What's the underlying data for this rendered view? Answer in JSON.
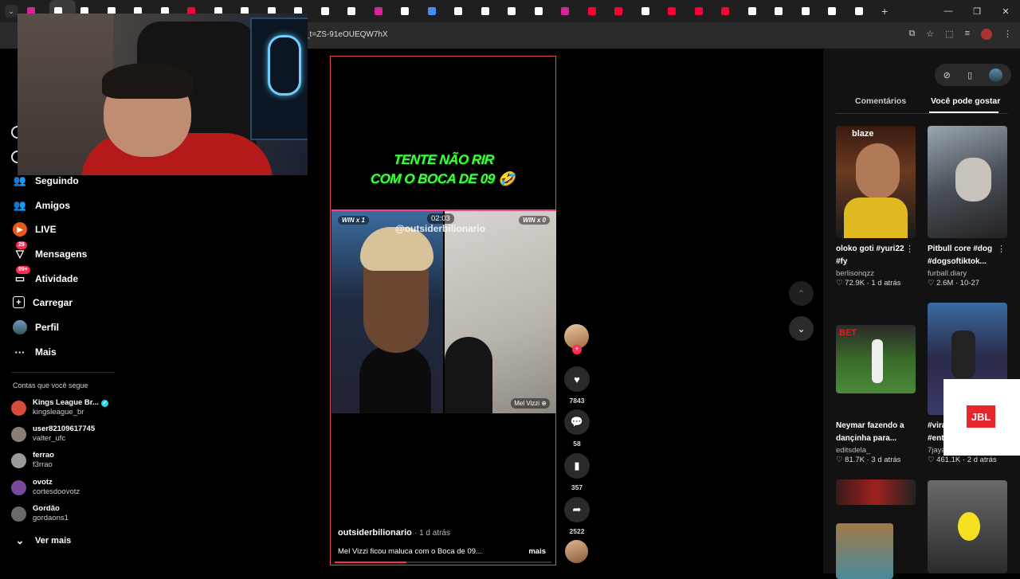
{
  "browser": {
    "url": "_t=ZS-91eOUEQW7hX",
    "tabs": [
      {
        "icon": "instagram",
        "color": "#d6249f"
      },
      {
        "icon": "tiktok",
        "color": "#fff",
        "active": true
      },
      {
        "icon": "tiktok",
        "color": "#fff"
      },
      {
        "icon": "tiktok",
        "color": "#fff"
      },
      {
        "icon": "tiktok",
        "color": "#fff"
      },
      {
        "icon": "tiktok",
        "color": "#fff"
      },
      {
        "icon": "youtube",
        "color": "#ff0033"
      },
      {
        "icon": "tiktok",
        "color": "#fff"
      },
      {
        "icon": "tiktok",
        "color": "#fff"
      },
      {
        "icon": "tiktok",
        "color": "#fff"
      },
      {
        "icon": "tiktok",
        "color": "#fff"
      },
      {
        "icon": "x",
        "color": "#fff"
      },
      {
        "icon": "tiktok",
        "color": "#fff"
      },
      {
        "icon": "instagram",
        "color": "#d6249f"
      },
      {
        "icon": "tiktok",
        "color": "#fff"
      },
      {
        "icon": "sheets",
        "color": "#4a8af4"
      },
      {
        "icon": "tiktok",
        "color": "#fff"
      },
      {
        "icon": "x",
        "color": "#fff"
      },
      {
        "icon": "tiktok",
        "color": "#fff"
      },
      {
        "icon": "tiktok",
        "color": "#fff"
      },
      {
        "icon": "instagram",
        "color": "#d6249f"
      },
      {
        "icon": "youtube",
        "color": "#ff0033"
      },
      {
        "icon": "youtube",
        "color": "#ff0033"
      },
      {
        "icon": "tiktok",
        "color": "#fff"
      },
      {
        "icon": "youtube",
        "color": "#ff0033"
      },
      {
        "icon": "youtube",
        "color": "#ff0033"
      },
      {
        "icon": "youtube",
        "color": "#ff0033"
      },
      {
        "icon": "tiktok",
        "color": "#fff"
      },
      {
        "icon": "tiktok",
        "color": "#fff"
      },
      {
        "icon": "tiktok",
        "color": "#fff"
      },
      {
        "icon": "tiktok",
        "color": "#fff"
      },
      {
        "icon": "tiktok",
        "color": "#fff"
      }
    ]
  },
  "sidebar": {
    "nav": [
      {
        "label": "Seguindo",
        "icon": "following-icon"
      },
      {
        "label": "Amigos",
        "icon": "friends-icon"
      },
      {
        "label": "LIVE",
        "icon": "live-icon"
      },
      {
        "label": "Mensagens",
        "icon": "messages-icon",
        "badge": "29"
      },
      {
        "label": "Atividade",
        "icon": "activity-icon",
        "badge": "99+"
      },
      {
        "label": "Carregar",
        "icon": "upload-icon"
      },
      {
        "label": "Perfil",
        "icon": "profile-icon"
      },
      {
        "label": "Mais",
        "icon": "more-icon"
      }
    ],
    "section_title": "Contas que você segue",
    "accounts": [
      {
        "name": "Kings League Br...",
        "handle": "kingsleague_br",
        "verified": true,
        "color": "#d84a3a"
      },
      {
        "name": "user82109617745",
        "handle": "valter_ufc",
        "color": "#8a7e74"
      },
      {
        "name": "ferrao",
        "handle": "f3rrao",
        "color": "#9a9a9a"
      },
      {
        "name": "ovotz",
        "handle": "cortesdoovotz",
        "color": "#7a4a9a"
      },
      {
        "name": "Gordão",
        "handle": "gordaons1",
        "color": "#6a6a6a"
      }
    ],
    "see_more": "Ver mais"
  },
  "video": {
    "caption_line1": "TENTE NÃO RIR",
    "caption_line2": "COM O BOCA DE 09 🤣",
    "win_left": "WIN x 1",
    "win_right": "WIN x 0",
    "timer": "02:03",
    "watermark": "@outsiderbilionario",
    "live_label": "Mel Vizzi ⊕",
    "author": "outsiderbilionario",
    "time_ago": "· 1 d atrás",
    "description": "Mel Vizzi ficou maluca com o Boca de 09...",
    "more": "mais",
    "progress": 0.33
  },
  "actions": {
    "likes": "7843",
    "comments": "58",
    "saves": "357",
    "shares": "2522"
  },
  "right_panel": {
    "tab_comments": "Comentários",
    "tab_recommended": "Você pode gostar",
    "cards": [
      {
        "title1": "oloko goti #yuri22",
        "title2": "#fy",
        "author": "berlisonqzz",
        "likes": "♡ 72.9K",
        "date": "· 1 d atrás",
        "thumb_label": "blaze"
      },
      {
        "title1": "Pitbull core #dog",
        "title2": "#dogsoftiktok...",
        "author": "furball.diary",
        "likes": "♡ 2.6M",
        "date": "· 10-27"
      },
      {
        "title1": "Neymar fazendo a",
        "title2": "dançinha para...",
        "author": "editsdela_",
        "likes": "♡ 81.7K",
        "date": "· 3 d atrás",
        "thumb_label": "BET"
      },
      {
        "title1": "#vira",
        "title2": "#ent",
        "author": "7jaya",
        "likes": "♡ 461.1K",
        "date": "· 2 d atrás"
      }
    ]
  },
  "ad": {
    "brand": "JBL"
  }
}
